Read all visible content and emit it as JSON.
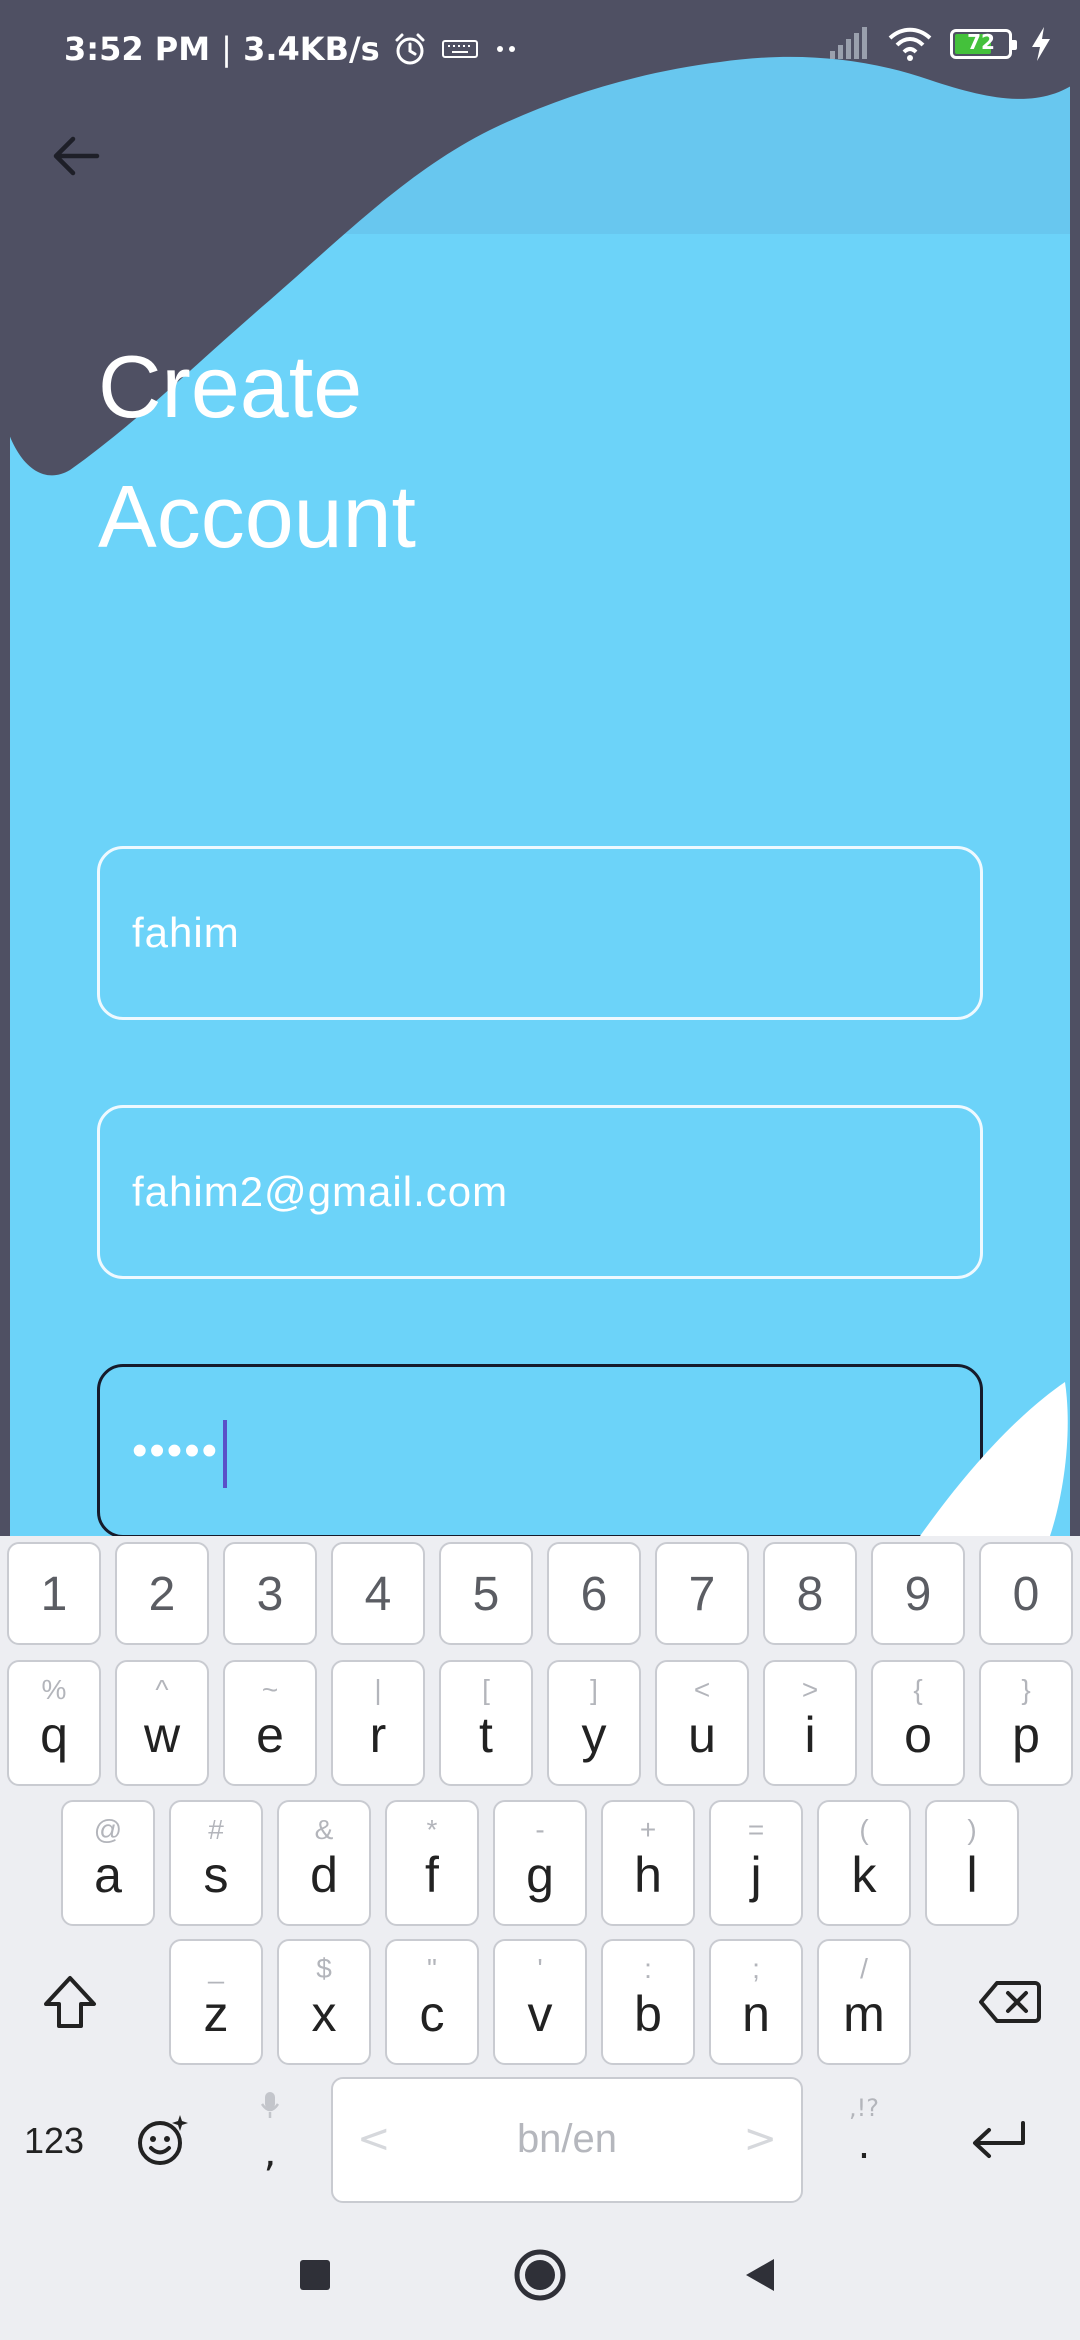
{
  "status_bar": {
    "time": "3:52 PM",
    "separator": "|",
    "speed": "3.4KB/s",
    "icons": [
      "alarm-icon",
      "keyboard-icon",
      "more-dots-icon",
      "signal-icon",
      "wifi-icon",
      "charging-icon"
    ],
    "battery_level": "72",
    "battery_color": "#44c13b"
  },
  "header": {
    "back_icon": "arrow-left-icon",
    "title_line1": "Create",
    "title_line2": "Account"
  },
  "form": {
    "name_value": "fahim",
    "email_value": "fahim2@gmail.com",
    "password_value": "•••••"
  },
  "keyboard": {
    "number_row": [
      "1",
      "2",
      "3",
      "4",
      "5",
      "6",
      "7",
      "8",
      "9",
      "0"
    ],
    "row1": [
      {
        "main": "q",
        "sub": "%"
      },
      {
        "main": "w",
        "sub": "^"
      },
      {
        "main": "e",
        "sub": "~"
      },
      {
        "main": "r",
        "sub": "|"
      },
      {
        "main": "t",
        "sub": "["
      },
      {
        "main": "y",
        "sub": "]"
      },
      {
        "main": "u",
        "sub": "<"
      },
      {
        "main": "i",
        "sub": ">"
      },
      {
        "main": "o",
        "sub": "{"
      },
      {
        "main": "p",
        "sub": "}"
      }
    ],
    "row2": [
      {
        "main": "a",
        "sub": "@"
      },
      {
        "main": "s",
        "sub": "#"
      },
      {
        "main": "d",
        "sub": "&"
      },
      {
        "main": "f",
        "sub": "*"
      },
      {
        "main": "g",
        "sub": "-"
      },
      {
        "main": "h",
        "sub": "+"
      },
      {
        "main": "j",
        "sub": "="
      },
      {
        "main": "k",
        "sub": "("
      },
      {
        "main": "l",
        "sub": ")"
      }
    ],
    "row3": [
      {
        "main": "z",
        "sub": "_"
      },
      {
        "main": "x",
        "sub": "$"
      },
      {
        "main": "c",
        "sub": "\""
      },
      {
        "main": "v",
        "sub": "'"
      },
      {
        "main": "b",
        "sub": ":"
      },
      {
        "main": "n",
        "sub": ";"
      },
      {
        "main": "m",
        "sub": "/"
      }
    ],
    "symbols_label": "123",
    "comma": ",",
    "space_label": "bn/en",
    "space_left": "<",
    "space_right": ">",
    "period": ".",
    "period_sub": ",!?",
    "shift_icon": "shift-icon",
    "backspace_icon": "backspace-icon",
    "emoji_icon": "emoji-icon",
    "mic_icon": "mic-icon",
    "enter_icon": "enter-icon"
  },
  "colors": {
    "background": "#6cd3f9",
    "app_bar": "#68c7ef",
    "dark_shape": "#4f5063",
    "field_border": "#eef9ff",
    "focused_border": "#161b2b",
    "caret": "#5a50c8"
  },
  "nav_bar": {
    "icons": [
      "recents-square-icon",
      "home-circle-icon",
      "back-triangle-icon"
    ]
  }
}
